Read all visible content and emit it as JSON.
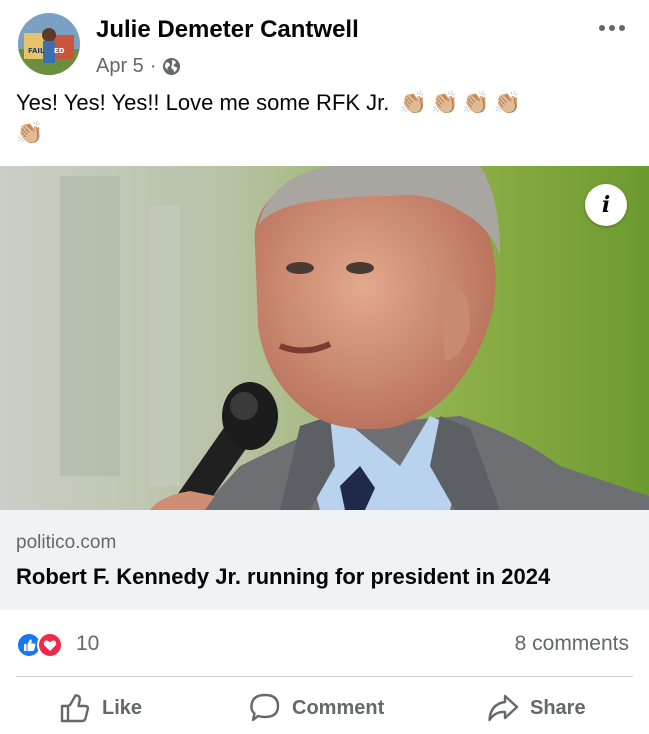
{
  "post": {
    "author": "Julie Demeter Cantwell",
    "date": "Apr 5",
    "separator": "·",
    "text": "Yes! Yes! Yes!!    Love me some RFK Jr.",
    "emoji": [
      "👏🏼",
      "👏🏼",
      "👏🏼",
      "👏🏼",
      "👏🏼"
    ]
  },
  "link_card": {
    "domain": "politico.com",
    "title": "Robert F. Kennedy Jr. running for president in 2024"
  },
  "engagement": {
    "reaction_count": "10",
    "comments": "8 comments"
  },
  "actions": {
    "like": "Like",
    "comment": "Comment",
    "share": "Share"
  },
  "colors": {
    "secondary_text": "#65676b",
    "like_blue": "#1877f2",
    "love_red": "#f02849",
    "card_bg": "#f0f2f5"
  }
}
